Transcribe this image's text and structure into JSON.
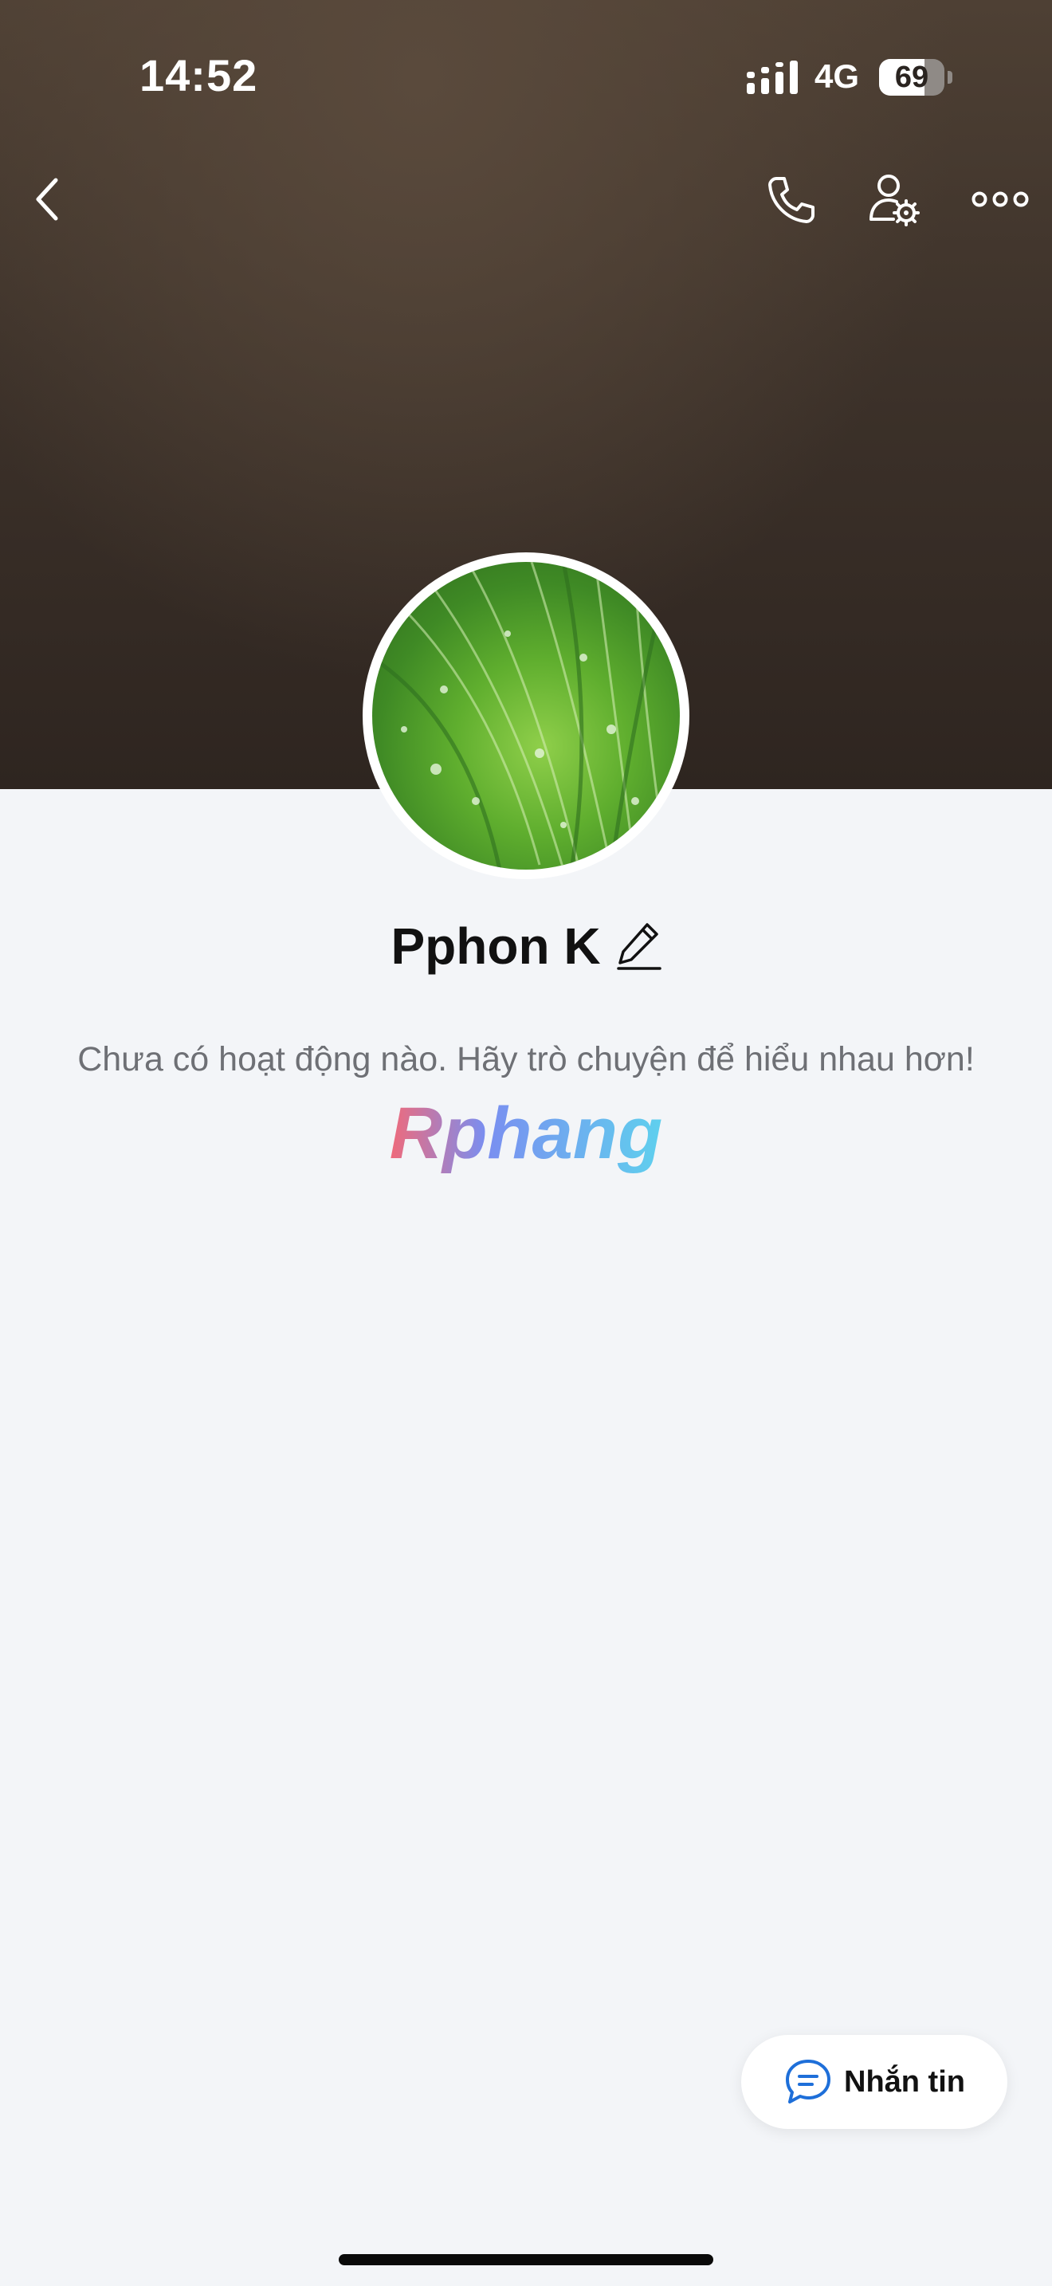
{
  "status_bar": {
    "time": "14:52",
    "network": "4G",
    "battery_level": "69",
    "battery_fraction": 0.69
  },
  "header": {
    "icons": [
      "back-icon",
      "phone-icon",
      "user-settings-icon",
      "more-icon"
    ]
  },
  "profile": {
    "name": "Pphon K",
    "empty_message": "Chưa có hoạt động nào. Hãy trò chuyện để hiểu nhau hơn!",
    "watermark": "Rphang"
  },
  "actions": {
    "message_label": "Nhắn tin"
  },
  "colors": {
    "cover_dark": "#3d322a",
    "background": "#f3f5f8",
    "accent_blue": "#1e6fd9"
  }
}
